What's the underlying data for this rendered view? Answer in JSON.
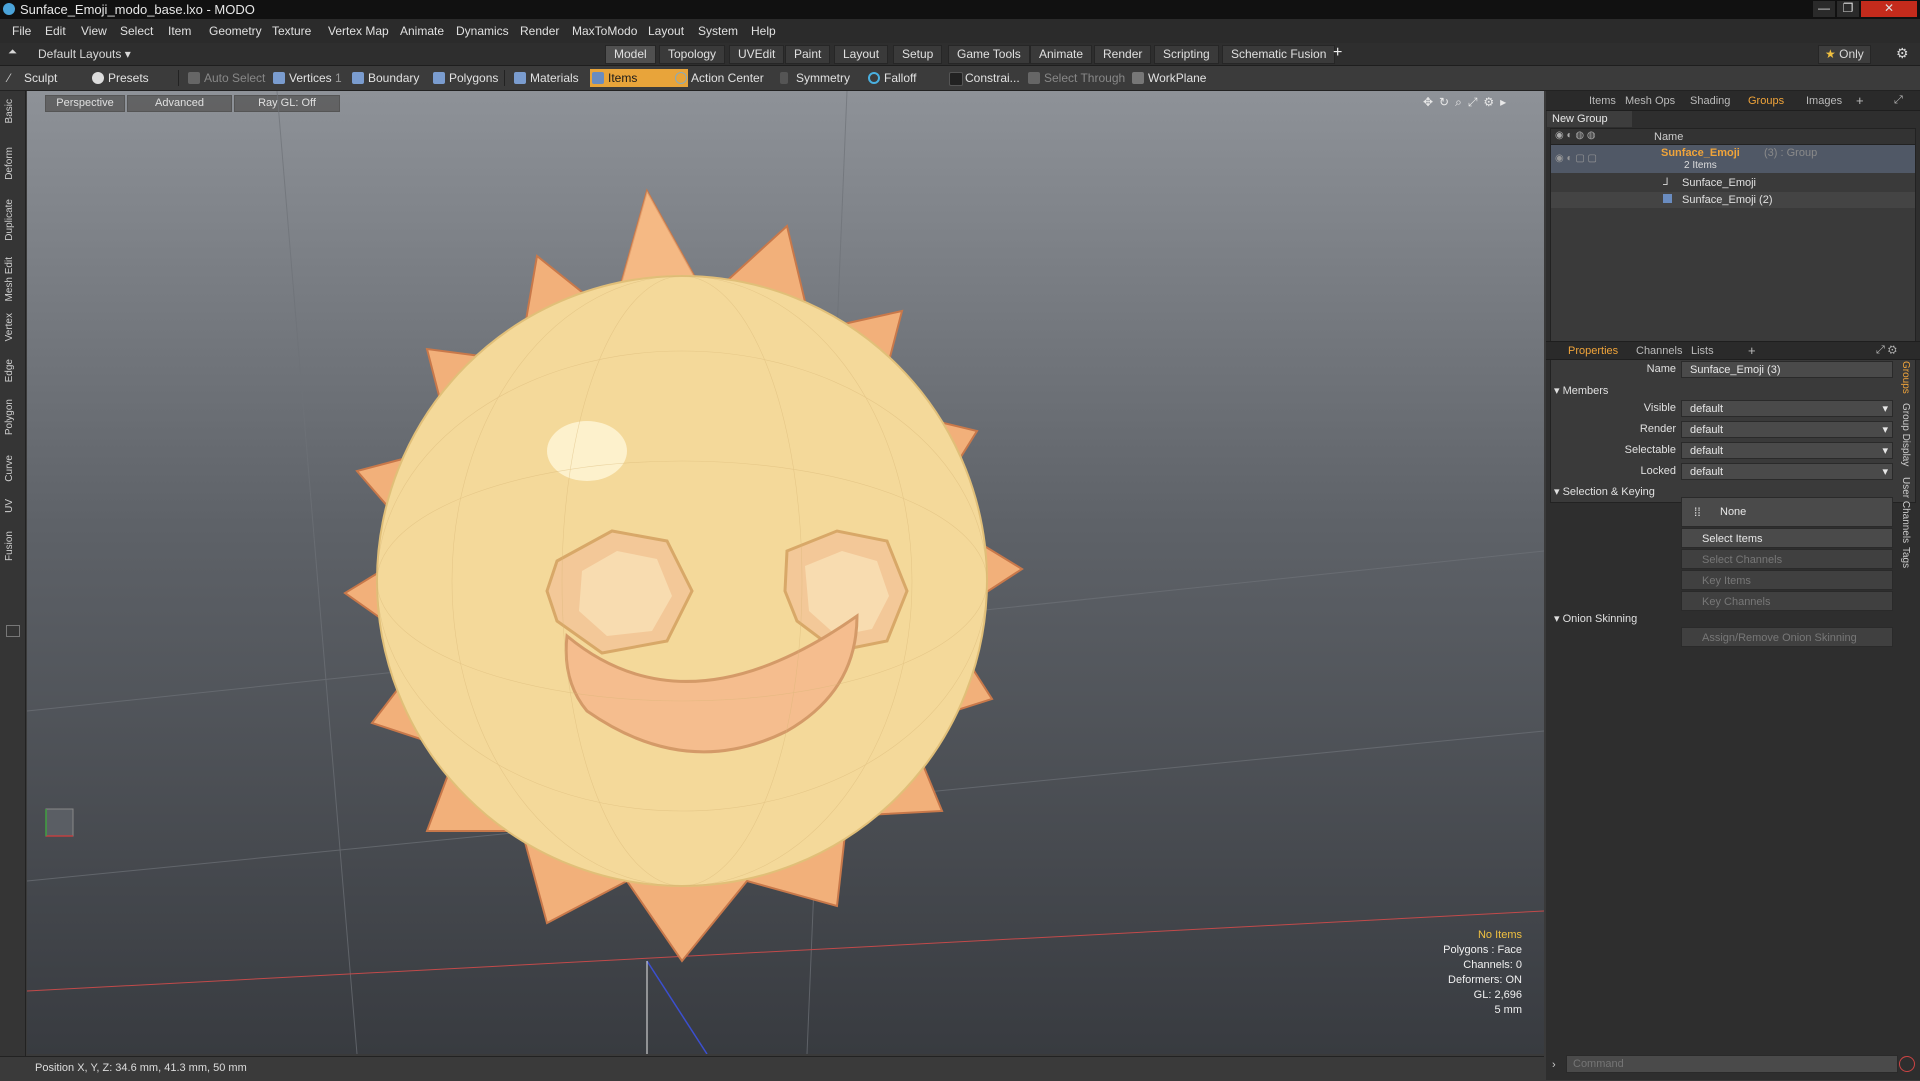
{
  "window": {
    "title": "Sunface_Emoji_modo_base.lxo - MODO",
    "buttons": [
      "—",
      "❐",
      "✕"
    ]
  },
  "menu": [
    "File",
    "Edit",
    "View",
    "Select",
    "Item",
    "Geometry",
    "Texture",
    "Vertex Map",
    "Animate",
    "Dynamics",
    "Render",
    "MaxToModo",
    "Layout",
    "System",
    "Help"
  ],
  "layouts": {
    "dropdown": "Default Layouts",
    "tabs": [
      "Model",
      "Topology",
      "UVEdit",
      "Paint",
      "Layout",
      "Setup",
      "Game Tools",
      "Animate",
      "Render",
      "Scripting",
      "Schematic Fusion"
    ],
    "active_tab": "Model",
    "plus": "+",
    "only": "Only"
  },
  "toolbar": {
    "sculpt": "Sculpt",
    "presets": "Presets",
    "auto_select": "Auto Select",
    "vertices": "Vertices",
    "vertices_count": "1",
    "boundary": "Boundary",
    "polygons": "Polygons",
    "materials": "Materials",
    "items": "Items",
    "action_center": "Action Center",
    "symmetry": "Symmetry",
    "falloff": "Falloff",
    "constraints": "Constrai...",
    "select_through": "Select Through",
    "workplane": "WorkPlane"
  },
  "left_tabs": [
    "Basic",
    "Deform",
    "Duplicate",
    "Mesh Edit",
    "Vertex",
    "Edge",
    "Polygon",
    "Curve",
    "UV",
    "Fusion"
  ],
  "viewport": {
    "view": "Perspective",
    "shading": "Advanced",
    "raygl": "Ray GL: Off",
    "info": [
      "No Items",
      "Polygons : Face",
      "Channels: 0",
      "Deformers: ON",
      "GL: 2,696",
      "5 mm"
    ]
  },
  "status": {
    "position": "Position X, Y, Z:  34.6 mm, 41.3 mm, 50 mm"
  },
  "top_panel": {
    "tabs": [
      "Items",
      "Mesh Ops",
      "Shading",
      "Groups",
      "Images"
    ],
    "active_tab": "Groups",
    "new_group": "New Group",
    "col_name": "Name",
    "group_name": "Sunface_Emoji",
    "group_suffix": "(3) : Group",
    "group_count": "2 Items",
    "children": [
      "Sunface_Emoji",
      "Sunface_Emoji (2)"
    ]
  },
  "properties": {
    "tabs": [
      "Properties",
      "Channels",
      "Lists"
    ],
    "active_tab": "Properties",
    "name_label": "Name",
    "name_value": "Sunface_Emoji (3)",
    "members_section": "Members",
    "fields": [
      {
        "label": "Visible",
        "value": "default"
      },
      {
        "label": "Render",
        "value": "default"
      },
      {
        "label": "Selectable",
        "value": "default"
      },
      {
        "label": "Locked",
        "value": "default"
      }
    ],
    "selection_section": "Selection & Keying",
    "none_btn": "None",
    "select_items": "Select Items",
    "select_channels": "Select Channels",
    "key_items": "Key Items",
    "key_channels": "Key Channels",
    "onion_section": "Onion Skinning",
    "onion_btn": "Assign/Remove Onion Skinning",
    "side_tabs": [
      "Groups",
      "Group Display",
      "User Channels",
      "Tags"
    ]
  },
  "command": {
    "placeholder": "Command"
  },
  "colors": {
    "accent": "#e8a43a",
    "sun_face": "#f4d99a",
    "sun_rays": "#f0a866"
  }
}
